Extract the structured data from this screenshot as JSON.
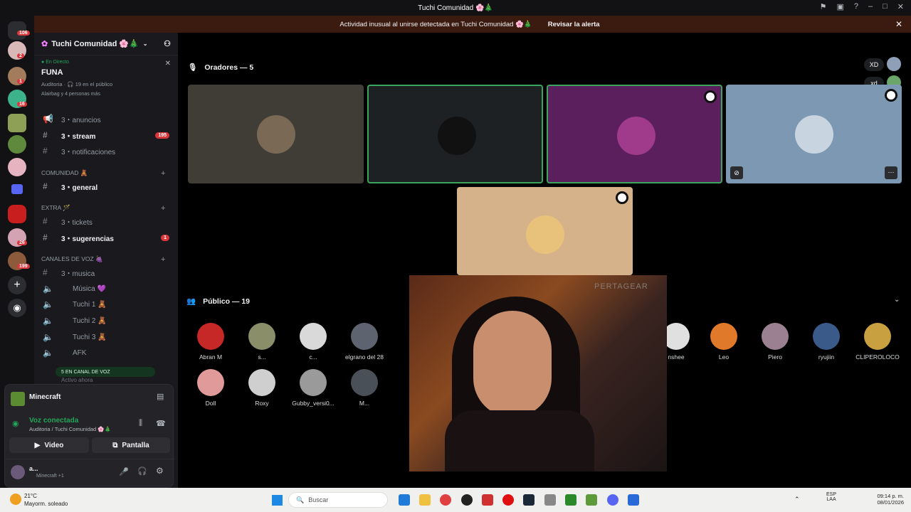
{
  "window_title": "Tuchi Comunidad 🌸🎄",
  "alert": {
    "text": "Actividad inusual al unirse detectada en Tuchi Comunidad 🌸🎄",
    "action": "Revisar la alerta"
  },
  "rail_badges": {
    "dm": "106",
    "s1": "2",
    "s2": "1",
    "s3": "16",
    "s4": "26",
    "s5": "199"
  },
  "server": {
    "name": "Tuchi Comunidad 🌸🎄"
  },
  "stage": {
    "status": "En Directo",
    "title": "FUNA",
    "meta": "Auditoria · 🎧 19 en el público",
    "listeners": "Alairbag y 4 personas más"
  },
  "channels": [
    {
      "label": "3・anuncios",
      "icon": "📢"
    },
    {
      "label": "3・stream",
      "badge": "195"
    },
    {
      "label": "3・notificaciones"
    }
  ],
  "cat_comunidad": "COMUNIDAD 🧸",
  "ch_general": "3・general",
  "cat_extra": "EXTRA 🪄",
  "ch_tickets": "3・tickets",
  "ch_sugerencias": {
    "label": "3・sugerencias",
    "badge": "1"
  },
  "cat_voz": "CANALES DE VOZ 🍇",
  "ch_musica": "3・musica",
  "voice": [
    "Música 💜",
    "Tuchi 1 🧸",
    "Tuchi 2 🧸",
    "Tuchi 3 🧸",
    "AFK"
  ],
  "vc_pill": "5 EN CANAL DE VOZ",
  "active_now": "Activo ahora",
  "activity": {
    "game": "Minecraft"
  },
  "voice_conn": {
    "status": "Voz conectada",
    "channel": "Auditoria / Tuchi Comunidad 🌸🎄"
  },
  "buttons": {
    "video": "Video",
    "screen": "Pantalla"
  },
  "user": {
    "name": "a...",
    "status": "Minecraft +1"
  },
  "speakers_header": "Oradores — 5",
  "top_right": {
    "xd1": "XD",
    "xd2": "xd"
  },
  "audience_header": "Público — 19",
  "audience_row1": [
    "Abran M",
    "s...",
    "c...",
    "elgrano del 28",
    "nshee",
    "Leo",
    "Piero",
    "ryujiin",
    "CLIPEROLOCO"
  ],
  "audience_row2": [
    "Doll",
    "Roxy",
    "Gubby_versi0...",
    "M..."
  ],
  "webcam_brand": "PERTAGEAR",
  "taskbar": {
    "weather_temp": "21°C",
    "weather_desc": "Mayorm. soleado",
    "search": "Buscar",
    "lang1": "ESP",
    "lang2": "LAA",
    "time": "09:14 p. m.",
    "date": "08/01/2026"
  }
}
